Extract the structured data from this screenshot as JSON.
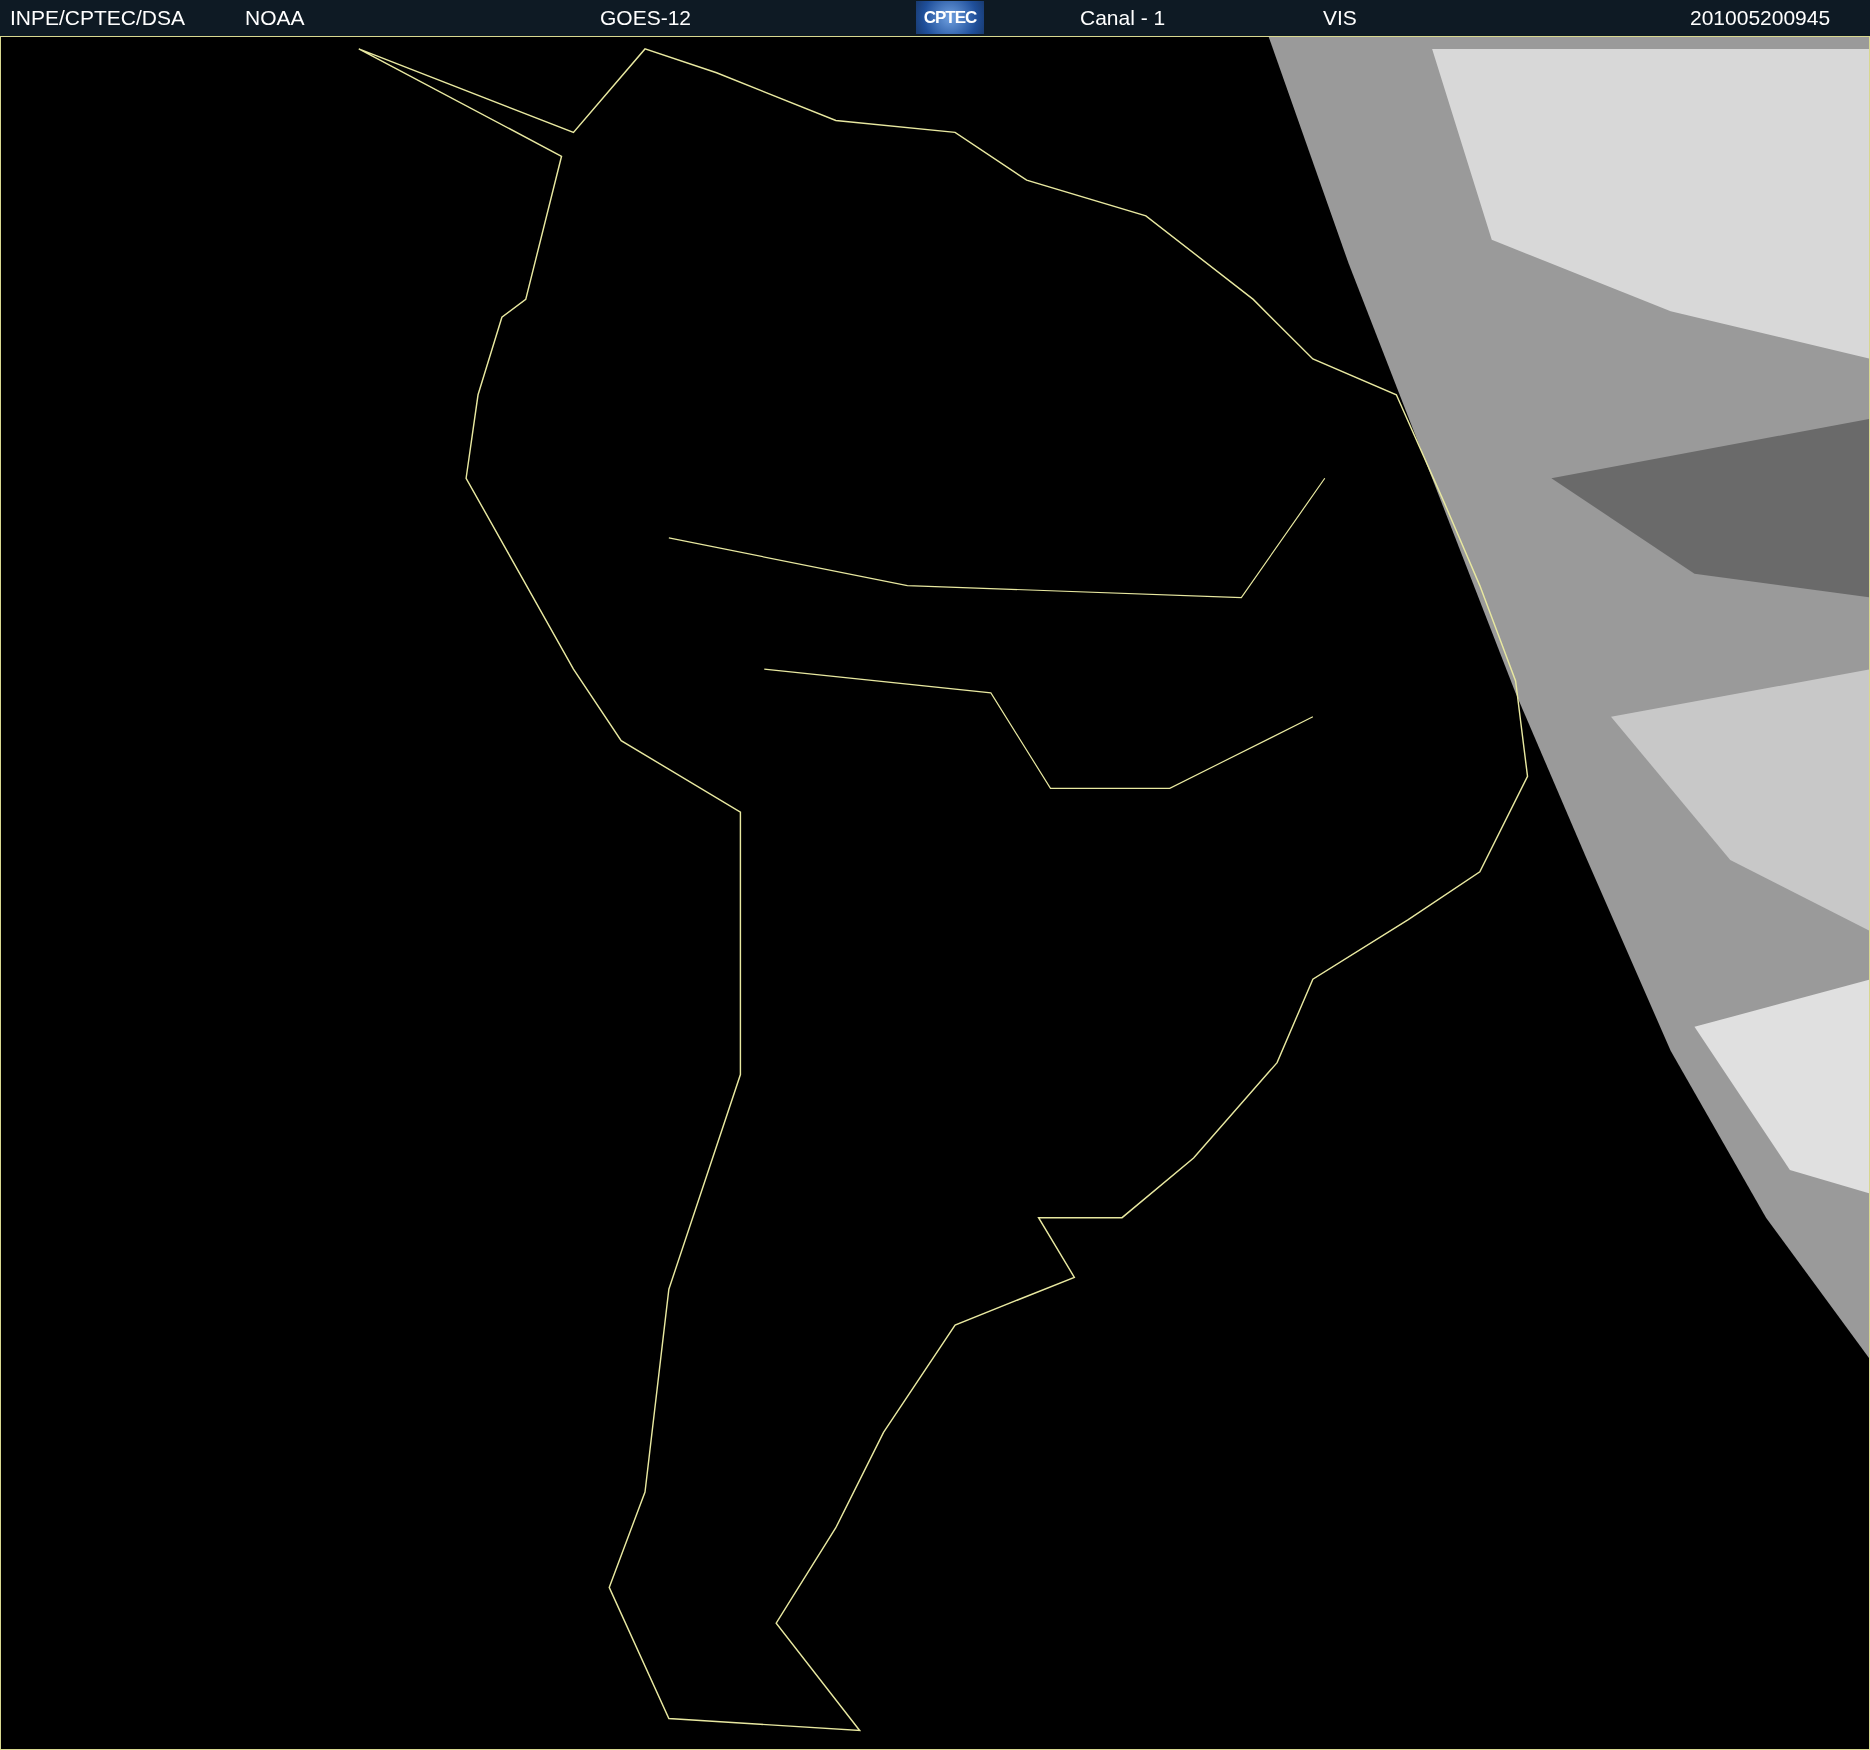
{
  "header": {
    "items": [
      {
        "kind": "text",
        "text": "INPE/CPTEC/DSA"
      },
      {
        "kind": "text",
        "text": "NOAA"
      },
      {
        "kind": "text",
        "text": "GOES-12"
      },
      {
        "kind": "logo",
        "text": "CPTEC"
      },
      {
        "kind": "text",
        "text": "Canal - 1"
      },
      {
        "kind": "text",
        "text": "VIS"
      },
      {
        "kind": "text",
        "text": "201005200945"
      }
    ]
  }
}
